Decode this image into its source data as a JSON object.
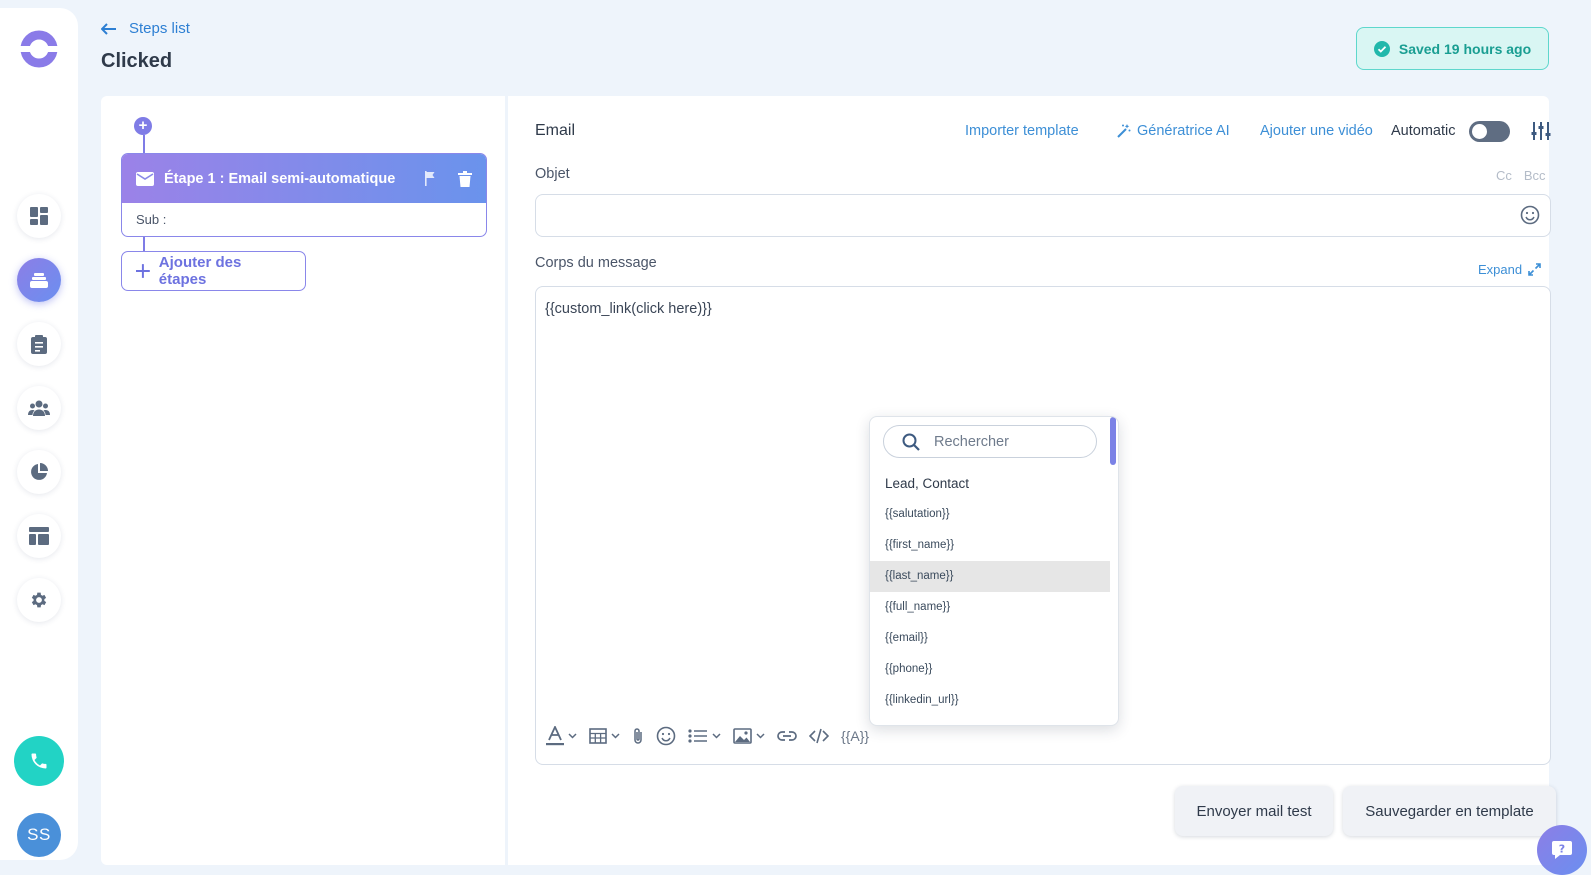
{
  "header": {
    "back_label": "Steps list",
    "page_title": "Clicked",
    "saved_status": "Saved 19 hours ago"
  },
  "sidebar": {
    "items": [
      {
        "icon": "dashboard-icon"
      },
      {
        "icon": "sequences-icon",
        "active": true
      },
      {
        "icon": "clipboard-icon"
      },
      {
        "icon": "team-icon"
      },
      {
        "icon": "pie-chart-icon"
      },
      {
        "icon": "layout-icon"
      },
      {
        "icon": "gear-icon"
      }
    ],
    "avatar_initials": "SS"
  },
  "steps": {
    "step1_title": "Étape 1 : Email semi-automatique",
    "step1_sub": "Sub :",
    "add_steps_label": "Ajouter des étapes"
  },
  "editor": {
    "section_label": "Email",
    "import_template": "Importer template",
    "ai_generator": "Génératrice AI",
    "add_video": "Ajouter une vidéo",
    "automatic_label": "Automatic",
    "automatic_enabled": false,
    "subject_label": "Objet",
    "cc": "Cc",
    "bcc": "Bcc",
    "subject_value": "",
    "body_label": "Corps du message",
    "expand_label": "Expand",
    "body_content": "{{custom_link(click here)}}",
    "variable_token": "{{A}}"
  },
  "variables_dropdown": {
    "search_placeholder": "Rechercher",
    "group_label": "Lead, Contact",
    "items": [
      "{{salutation}}",
      "{{first_name}}",
      "{{last_name}}",
      "{{full_name}}",
      "{{email}}",
      "{{phone}}",
      "{{linkedin_url}}"
    ],
    "hovered_item": "{{last_name}}"
  },
  "actions": {
    "send_test": "Envoyer mail test",
    "save_template": "Sauvegarder en template"
  },
  "colors": {
    "accent_purple": "#7f7ce6",
    "link_blue": "#3d8fd6",
    "saved_teal": "#1a9e92",
    "phone_teal": "#22d3c5"
  }
}
